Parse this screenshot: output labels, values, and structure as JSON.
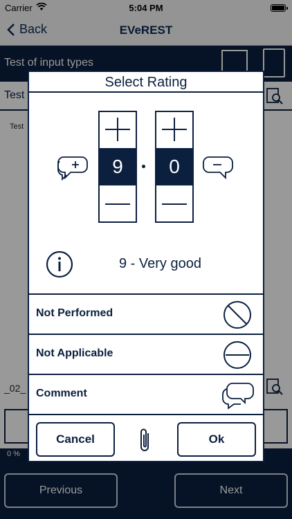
{
  "status_bar": {
    "carrier": "Carrier",
    "time": "5:04 PM"
  },
  "nav": {
    "back_label": "Back",
    "title": "EVeREST"
  },
  "screen": {
    "section_title": "Test of input types",
    "row1_text": "Test",
    "row_small_text": "Test",
    "row_bottom_text": "_02_",
    "progress_text": "0 %",
    "previous_label": "Previous",
    "next_label": "Next"
  },
  "modal": {
    "title": "Select Rating",
    "digit_left": "9",
    "digit_right": "0",
    "rating_text": "9 - Very good",
    "options": [
      {
        "label": "Not Performed",
        "icon": "not-performed-icon"
      },
      {
        "label": "Not Applicable",
        "icon": "not-applicable-icon"
      },
      {
        "label": "Comment",
        "icon": "comment-icon"
      }
    ],
    "cancel_label": "Cancel",
    "ok_label": "Ok"
  },
  "colors": {
    "navy": "#0b1f3f",
    "overlay": "rgba(0,0,0,0.40)"
  }
}
